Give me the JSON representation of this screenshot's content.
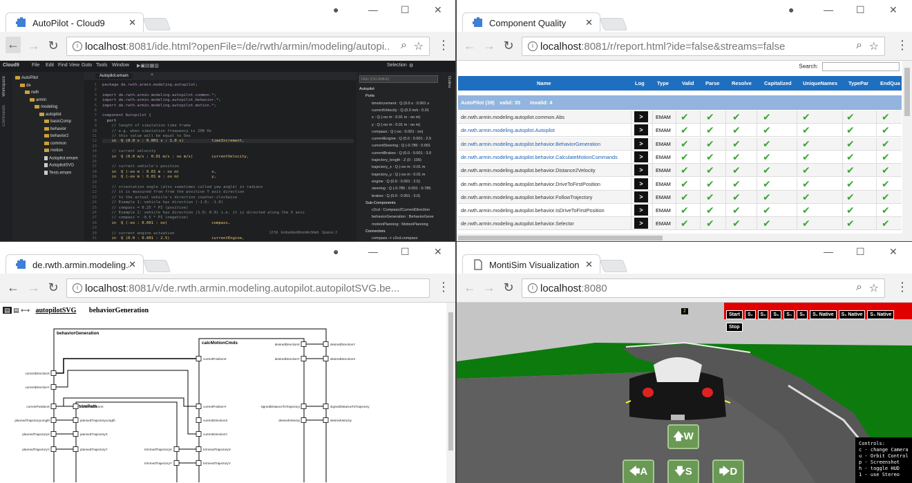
{
  "windows": {
    "cloud9": {
      "tab_title": "AutoPilot - Cloud9",
      "url_host": "localhost",
      "url_rest": ":8081/ide.html?openFile=/de/rwth/armin/modeling/autopi...",
      "menu": [
        "Cloud9",
        "File",
        "Edit",
        "Find",
        "View",
        "Goto",
        "Tools",
        "Window"
      ],
      "side_labels": [
        "Workspace",
        "Commands"
      ],
      "selection_label": "Selection",
      "tree": [
        {
          "label": "AutoPilot",
          "depth": 0,
          "kind": "folder"
        },
        {
          "label": "de",
          "depth": 1,
          "kind": "folder"
        },
        {
          "label": "rwth",
          "depth": 2,
          "kind": "folder"
        },
        {
          "label": "armin",
          "depth": 3,
          "kind": "folder"
        },
        {
          "label": "modeling",
          "depth": 4,
          "kind": "folder"
        },
        {
          "label": "autopilot",
          "depth": 5,
          "kind": "folder"
        },
        {
          "label": "basicComp",
          "depth": 6,
          "kind": "folder"
        },
        {
          "label": "behavior",
          "depth": 6,
          "kind": "folder"
        },
        {
          "label": "behavior2",
          "depth": 6,
          "kind": "folder"
        },
        {
          "label": "common",
          "depth": 6,
          "kind": "folder"
        },
        {
          "label": "motion",
          "depth": 6,
          "kind": "folder"
        },
        {
          "label": "Autopilot.emam",
          "depth": 6,
          "kind": "file"
        },
        {
          "label": "AutopilotSVG",
          "depth": 6,
          "kind": "file"
        },
        {
          "label": "Tests.emam",
          "depth": 6,
          "kind": "file"
        }
      ],
      "editor_tab": "Autopilot.emam",
      "code": [
        "package de.rwth.armin.modeling.autopilot;",
        "",
        "import de.rwth.armin.modeling.autopilot.common.*;",
        "import de.rwth.armin.modeling.autopilot.behavior.*;",
        "import de.rwth.armin.modeling.autopilot.motion.*;",
        "",
        "component Autopilot {",
        "  port",
        "    // length of simulation time frame",
        "    // e.g. when simulation frequency is 200 Hz",
        "    // this value will be equal to 5ms",
        "    in  Q (0.0 s : 0.001 s : 1.0 s)            timeIncrement,",
        "",
        "    // current velocity",
        "    in  Q (0.0 m/s : 0.01 m/s : oo m/s)        currentVelocity,",
        "",
        "    // current vehicle's position",
        "    in  Q (-oo m : 0.01 m : oo m)              x,",
        "    in  Q (-oo m : 0.01 m : oo m)              y,",
        "",
        "    // orientation angle (also sometimes called yaw angle) in radians",
        "    // it is measured from from the positive Y axis direction",
        "    // to the actual vehicle's direction counter-clockwise",
        "    // Example 1: vehicle has direction (-1.0; -1.0)",
        "    // compass = 0.25 * PI (positive)",
        "    // Example 2: vehicle has direction (1.0; 0.0) i.e. it is directed along the X axis",
        "    // compass = -0.5 * PI (negative)",
        "    in  Q (-oo : 0.001 : oo)                   compass,",
        "",
        "    // current engine actuation",
        "    in  Q (0.0 : 0.001 : 2.5)                  currentEngine,"
      ],
      "status": "12:56   EmbeddedMontiArcMath   Spaces: 2",
      "filter_placeholder": "Filter (Ctrl-Shift-E)",
      "outline_label": "Outline",
      "outline": [
        {
          "label": "Autopilot",
          "depth": 0
        },
        {
          "label": "Ports",
          "depth": 1
        },
        {
          "label": "timeIncrement : Q (0.0 s : 0.001 s",
          "depth": 2
        },
        {
          "label": "currentVelocity : Q (0.0 m/s : 0.01",
          "depth": 2
        },
        {
          "label": "x : Q (-oo m : 0.01 m : oo m)",
          "depth": 2
        },
        {
          "label": "y : Q (-oo m : 0.01 m : oo m)",
          "depth": 2
        },
        {
          "label": "compass : Q (-oo : 0.001 : oo)",
          "depth": 2
        },
        {
          "label": "currentEngine : Q (0.0 : 0.001 : 2.5",
          "depth": 2
        },
        {
          "label": "currentSteering : Q (-0.785 : 0.001",
          "depth": 2
        },
        {
          "label": "currentBrakes : Q (0.0 : 0.001 : 3.0",
          "depth": 2
        },
        {
          "label": "trajectory_length : Z (0 : 100)",
          "depth": 2
        },
        {
          "label": "trajectory_x : Q (-oo m : 0.01 m",
          "depth": 2
        },
        {
          "label": "trajectory_y : Q (-oo m : 0.01 m",
          "depth": 2
        },
        {
          "label": "engine : Q (0.0 : 0.001 : 2.5)",
          "depth": 2
        },
        {
          "label": "steering : Q (-0.785 : 0.001 : 0.785",
          "depth": 2
        },
        {
          "label": "brakes : Q (0.0 : 0.001 : 3.0)",
          "depth": 2
        },
        {
          "label": "Sub-Components",
          "depth": 1
        },
        {
          "label": "c2cd : Compass2CurrentDirection",
          "depth": 2
        },
        {
          "label": "behaviorGeneration : BehaviorGene",
          "depth": 2
        },
        {
          "label": "motionPlanning : MotionPlanning",
          "depth": 2
        },
        {
          "label": "Connectors",
          "depth": 1
        },
        {
          "label": "compass -> c2cd.compass",
          "depth": 2
        }
      ]
    },
    "report": {
      "tab_title": "Component Quality",
      "url_host": "localhost",
      "url_rest": ":8081/r/report.html?ide=false&streams=false",
      "search_label": "Search:",
      "columns": [
        "Name",
        "Log",
        "Type",
        "Valid",
        "Parse",
        "Resolve",
        "Capitalized",
        "UniqueNames",
        "TypePar",
        "EndQua"
      ],
      "summary": {
        "name": "AutoPilot (39)",
        "valid": "valid: 35",
        "invalid": "invalid: 4"
      },
      "log_button": ">",
      "check_glyph": "✔",
      "rows": [
        {
          "name": "de.rwth.armin.modeling.autopilot.common.Abs",
          "type": "EMAM",
          "link": false
        },
        {
          "name": "de.rwth.armin.modeling.autopilot.Autopilot",
          "type": "EMAM",
          "link": true
        },
        {
          "name": "de.rwth.armin.modeling.autopilot.behavior.BehaviorGeneration",
          "type": "EMAM",
          "link": true
        },
        {
          "name": "de.rwth.armin.modeling.autopilot.behavior.CalculateMotionCommands",
          "type": "EMAM",
          "link": true
        },
        {
          "name": "de.rwth.armin.modeling.autopilot.behavior.Distance2Velocity",
          "type": "EMAM",
          "link": false
        },
        {
          "name": "de.rwth.armin.modeling.autopilot.behavior.DriveToFirstPosition",
          "type": "EMAM",
          "link": false
        },
        {
          "name": "de.rwth.armin.modeling.autopilot.behavior.FollowTrajectory",
          "type": "EMAM",
          "link": false
        },
        {
          "name": "de.rwth.armin.modeling.autopilot.behavior.IsDriveToFirstPosition",
          "type": "EMAM",
          "link": false
        },
        {
          "name": "de.rwth.armin.modeling.autopilot.behavior.Selector",
          "type": "EMAM",
          "link": false
        }
      ]
    },
    "svgview": {
      "tab_title": "de.rwth.armin.modeling.a",
      "url_host": "localhost",
      "url_rest": ":8081/v/de.rwth.armin.modeling.autopilot.autopilotSVG.be...",
      "breadcrumb_link": "autopilotSVG",
      "breadcrumb_current": "behaviorGeneration",
      "outer_block": "behaviorGeneration",
      "calc_block": "calcMotionCmds",
      "trim_block": "trimPath",
      "left_ports": [
        "currentDirectionX",
        "currentDirectionY",
        "currentPositionX",
        "plannedTrajectoryLength",
        "plannedTrajectoryX",
        "plannedTrajectoryY"
      ],
      "trim_ports_in": [
        "currentPositionX",
        "plannedTrajectoryLength",
        "plannedTrajectoryX",
        "plannedTrajectoryY"
      ],
      "trim_ports_out": [
        "trimmedTrajectoryX",
        "trimmedTrajectoryY"
      ],
      "calc_ports_in": [
        "currentPositionX",
        "currentPositionY",
        "currentDirectionX",
        "currentDirectionY",
        "trimmedTrajectoryX",
        "trimmedTrajectoryY"
      ],
      "calc_ports_out": [
        "desiredDirectionX",
        "desiredDirectionY",
        "signedDistanceToTrajectory",
        "desiredVelocity"
      ],
      "right_ports": [
        "desiredDirectionY",
        "desiredDirectionX",
        "signedDistanceToTrajectory",
        "desiredVelocity"
      ]
    },
    "monti": {
      "tab_title": "MontiSim Visualization",
      "url_host": "localhost",
      "url_rest": ":8080",
      "counter": "2",
      "buttons": [
        "Start",
        "S₁",
        "S₂",
        "S₃",
        "S₄",
        "S₅",
        "S₁ Native",
        "S₂ Native",
        "S₄ Native",
        "Stop"
      ],
      "controls": {
        "w": "🡅W",
        "a": "🡄A",
        "s": "🡇S",
        "d": "🡆D"
      },
      "help": "Controls:\nc - change Camera\nu - Orbit Control\np - Screenshot\nh - toggle HUD\n1 - use Stereo"
    }
  },
  "colors": {
    "report_header": "#1f6fc0",
    "report_summary": "#92b4de",
    "check": "#3aa635",
    "road": "#5a5a5a",
    "grass": "#0d7a0d",
    "sky": "#c5c5c5",
    "hud_bar": "#e00000"
  }
}
